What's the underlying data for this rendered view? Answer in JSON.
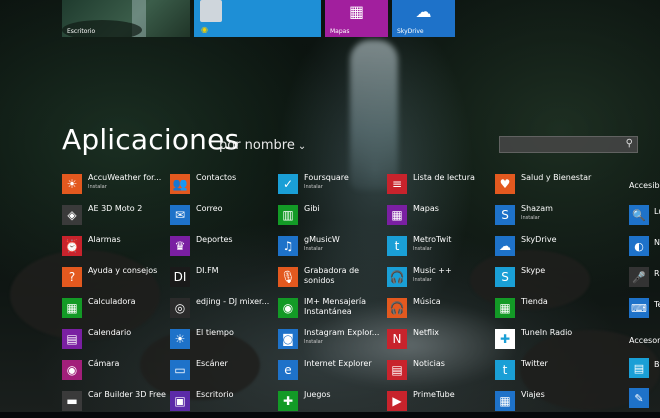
{
  "colors": {
    "orange": "#e3591f",
    "blue": "#1e72c9",
    "green": "#139a26",
    "purple": "#7a1fa2",
    "red": "#c8232c",
    "teal": "#1a9fd6"
  },
  "top_tiles": [
    {
      "label": "Escritorio",
      "icon": "desktop-photo-icon"
    },
    {
      "label": "",
      "icon": "people-icon"
    },
    {
      "label": "Mapas",
      "icon": "store-icon"
    },
    {
      "label": "SkyDrive",
      "icon": "cloud-icon"
    }
  ],
  "header": {
    "title": "Aplicaciones",
    "sort_label": "por nombre",
    "sort_chevron": "⌄",
    "search_placeholder": ""
  },
  "columns": [
    [
      {
        "name": "AccuWeather for...",
        "sub": "Instalar",
        "icon": "sun-icon",
        "color": "#e3591f"
      },
      {
        "name": "AE 3D Moto 2",
        "sub": "",
        "icon": "moto-icon",
        "color": "#3a3a3a"
      },
      {
        "name": "Alarmas",
        "sub": "",
        "icon": "alarm-icon",
        "color": "#c8232c"
      },
      {
        "name": "Ayuda y consejos",
        "sub": "",
        "icon": "help-icon",
        "color": "#e3591f"
      },
      {
        "name": "Calculadora",
        "sub": "",
        "icon": "calculator-icon",
        "color": "#139a26"
      },
      {
        "name": "Calendario",
        "sub": "",
        "icon": "calendar-icon",
        "color": "#7a1fa2"
      },
      {
        "name": "Cámara",
        "sub": "",
        "icon": "camera-icon",
        "color": "#a21f7a"
      },
      {
        "name": "Car Builder 3D Free",
        "sub": "",
        "icon": "car-icon",
        "color": "#3a3a3a"
      }
    ],
    [
      {
        "name": "Contactos",
        "sub": "",
        "icon": "people-icon",
        "color": "#e3591f"
      },
      {
        "name": "Correo",
        "sub": "",
        "icon": "mail-icon",
        "color": "#1e72c9"
      },
      {
        "name": "Deportes",
        "sub": "",
        "icon": "trophy-icon",
        "color": "#7a1fa2"
      },
      {
        "name": "DI.FM",
        "sub": "",
        "icon": "difm-icon",
        "color": "#1a1a1a"
      },
      {
        "name": "edjing - DJ mixer...",
        "sub": "",
        "icon": "dj-icon",
        "color": "#2b2b2b"
      },
      {
        "name": "El tiempo",
        "sub": "",
        "icon": "weather-icon",
        "color": "#1e72c9"
      },
      {
        "name": "Escáner",
        "sub": "",
        "icon": "scanner-icon",
        "color": "#1e72c9"
      },
      {
        "name": "Escritorio",
        "sub": "",
        "icon": "desktop-icon",
        "color": "#5b2aa8"
      }
    ],
    [
      {
        "name": "Foursquare",
        "sub": "Instalar",
        "icon": "foursquare-icon",
        "color": "#1a9fd6"
      },
      {
        "name": "Gibi",
        "sub": "",
        "icon": "book-icon",
        "color": "#139a26"
      },
      {
        "name": "gMusicW",
        "sub": "Instalar",
        "icon": "music-note-icon",
        "color": "#1e72c9"
      },
      {
        "name": "Grabadora de sonidos",
        "sub": "",
        "icon": "microphone-icon",
        "color": "#e3591f"
      },
      {
        "name": "IM+ Mensajería Instantánea",
        "sub": "",
        "icon": "chat-icon",
        "color": "#139a26"
      },
      {
        "name": "Instagram Explor...",
        "sub": "Instalar",
        "icon": "instagram-icon",
        "color": "#1e72c9"
      },
      {
        "name": "Internet Explorer",
        "sub": "",
        "icon": "ie-icon",
        "color": "#1e72c9"
      },
      {
        "name": "Juegos",
        "sub": "",
        "icon": "gamepad-icon",
        "color": "#139a26"
      }
    ],
    [
      {
        "name": "Lista de lectura",
        "sub": "",
        "icon": "reading-list-icon",
        "color": "#c8232c"
      },
      {
        "name": "Mapas",
        "sub": "",
        "icon": "map-icon",
        "color": "#7a1fa2"
      },
      {
        "name": "MetroTwit",
        "sub": "Instalar",
        "icon": "twitter-icon",
        "color": "#1a9fd6"
      },
      {
        "name": "Music ++",
        "sub": "Instalar",
        "icon": "headphones-icon",
        "color": "#1a9fd6"
      },
      {
        "name": "Música",
        "sub": "",
        "icon": "headphones-icon",
        "color": "#e3591f"
      },
      {
        "name": "Netflix",
        "sub": "",
        "icon": "netflix-icon",
        "color": "#c8232c"
      },
      {
        "name": "Noticias",
        "sub": "",
        "icon": "news-icon",
        "color": "#c8232c"
      },
      {
        "name": "PrimeTube",
        "sub": "",
        "icon": "video-icon",
        "color": "#c8232c"
      }
    ],
    [
      {
        "name": "Salud y Bienestar",
        "sub": "",
        "icon": "heart-icon",
        "color": "#e3591f"
      },
      {
        "name": "Shazam",
        "sub": "Instalar",
        "icon": "shazam-icon",
        "color": "#1e72c9"
      },
      {
        "name": "SkyDrive",
        "sub": "",
        "icon": "cloud-icon",
        "color": "#1e72c9"
      },
      {
        "name": "Skype",
        "sub": "",
        "icon": "skype-icon",
        "color": "#1a9fd6"
      },
      {
        "name": "Tienda",
        "sub": "",
        "icon": "store-icon",
        "color": "#139a26"
      },
      {
        "name": "TuneIn Radio",
        "sub": "",
        "icon": "radio-icon",
        "color": "#ffffff"
      },
      {
        "name": "Twitter",
        "sub": "",
        "icon": "twitter-icon",
        "color": "#1a9fd6"
      },
      {
        "name": "Viajes",
        "sub": "",
        "icon": "suitcase-icon",
        "color": "#1e72c9"
      }
    ]
  ],
  "right_column": {
    "category1": "Accesibili",
    "items1": [
      {
        "name": "Lu",
        "icon": "magnifier-icon"
      },
      {
        "name": "N",
        "icon": "narrator-icon"
      },
      {
        "name": "R",
        "icon": "microphone-icon"
      },
      {
        "name": "Te",
        "icon": "keyboard-icon"
      }
    ],
    "category2": "Accesorio",
    "items2": [
      {
        "name": "Bl",
        "icon": "notepad-icon"
      },
      {
        "name": "",
        "icon": "paint-icon"
      }
    ]
  }
}
